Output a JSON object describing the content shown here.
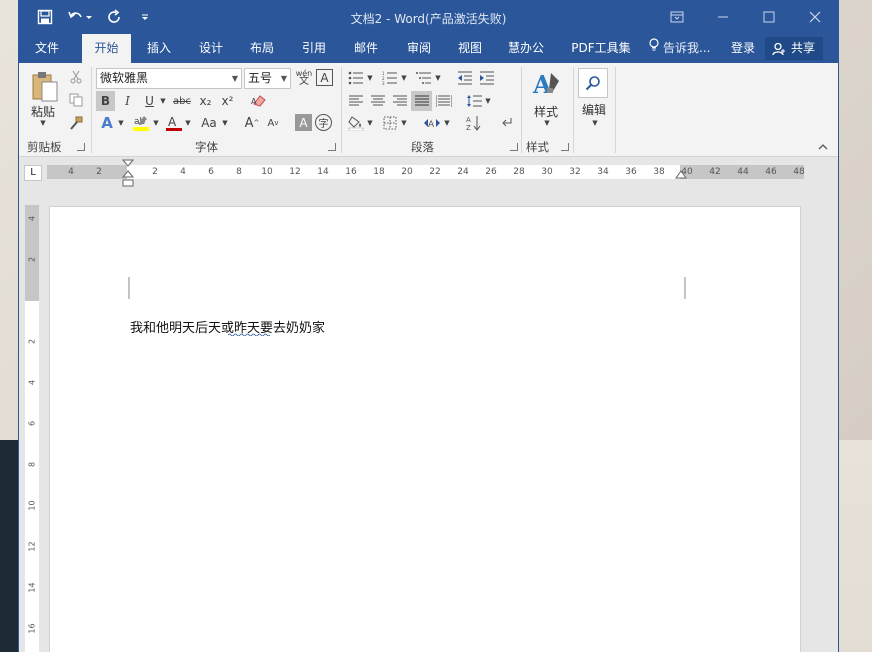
{
  "window": {
    "title": "文档2 - Word(产品激活失败)"
  },
  "quick_access": {
    "save_icon": "save-icon",
    "undo_icon": "undo-icon",
    "redo_icon": "redo-icon",
    "customize_icon": "customize-qat-icon"
  },
  "tabs": [
    {
      "label": "文件"
    },
    {
      "label": "开始"
    },
    {
      "label": "插入"
    },
    {
      "label": "设计"
    },
    {
      "label": "布局"
    },
    {
      "label": "引用"
    },
    {
      "label": "邮件"
    },
    {
      "label": "审阅"
    },
    {
      "label": "视图"
    },
    {
      "label": "慧办公"
    },
    {
      "label": "PDF工具集"
    }
  ],
  "tell_me": "告诉我...",
  "login_label": "登录",
  "share_label": "共享",
  "ribbon": {
    "clipboard": {
      "paste_label": "粘贴",
      "group_label": "剪贴板"
    },
    "font": {
      "font_name": "微软雅黑",
      "font_size": "五号",
      "group_label": "字体",
      "bold": "B",
      "italic": "I",
      "underline": "U",
      "strike": "abc",
      "sub": "x₂",
      "sup": "x²",
      "grow": "A",
      "shrink": "A",
      "case": "Aa",
      "wen": "wén"
    },
    "paragraph": {
      "group_label": "段落"
    },
    "styles": {
      "label": "样式",
      "group_label": "样式"
    },
    "editing": {
      "label": "编辑"
    }
  },
  "hruler_ticks": [
    "4",
    "2",
    "2",
    "4",
    "6",
    "8",
    "10",
    "12",
    "14",
    "16",
    "18",
    "20",
    "22",
    "24",
    "26",
    "28",
    "30",
    "32",
    "34",
    "36",
    "38",
    "40",
    "42",
    "44",
    "46",
    "48"
  ],
  "vruler_ticks": [
    "4",
    "2",
    "2",
    "4",
    "6",
    "8",
    "10",
    "12",
    "14",
    "16"
  ],
  "document": {
    "text": "我和他明天后天或昨天要去奶奶家"
  }
}
